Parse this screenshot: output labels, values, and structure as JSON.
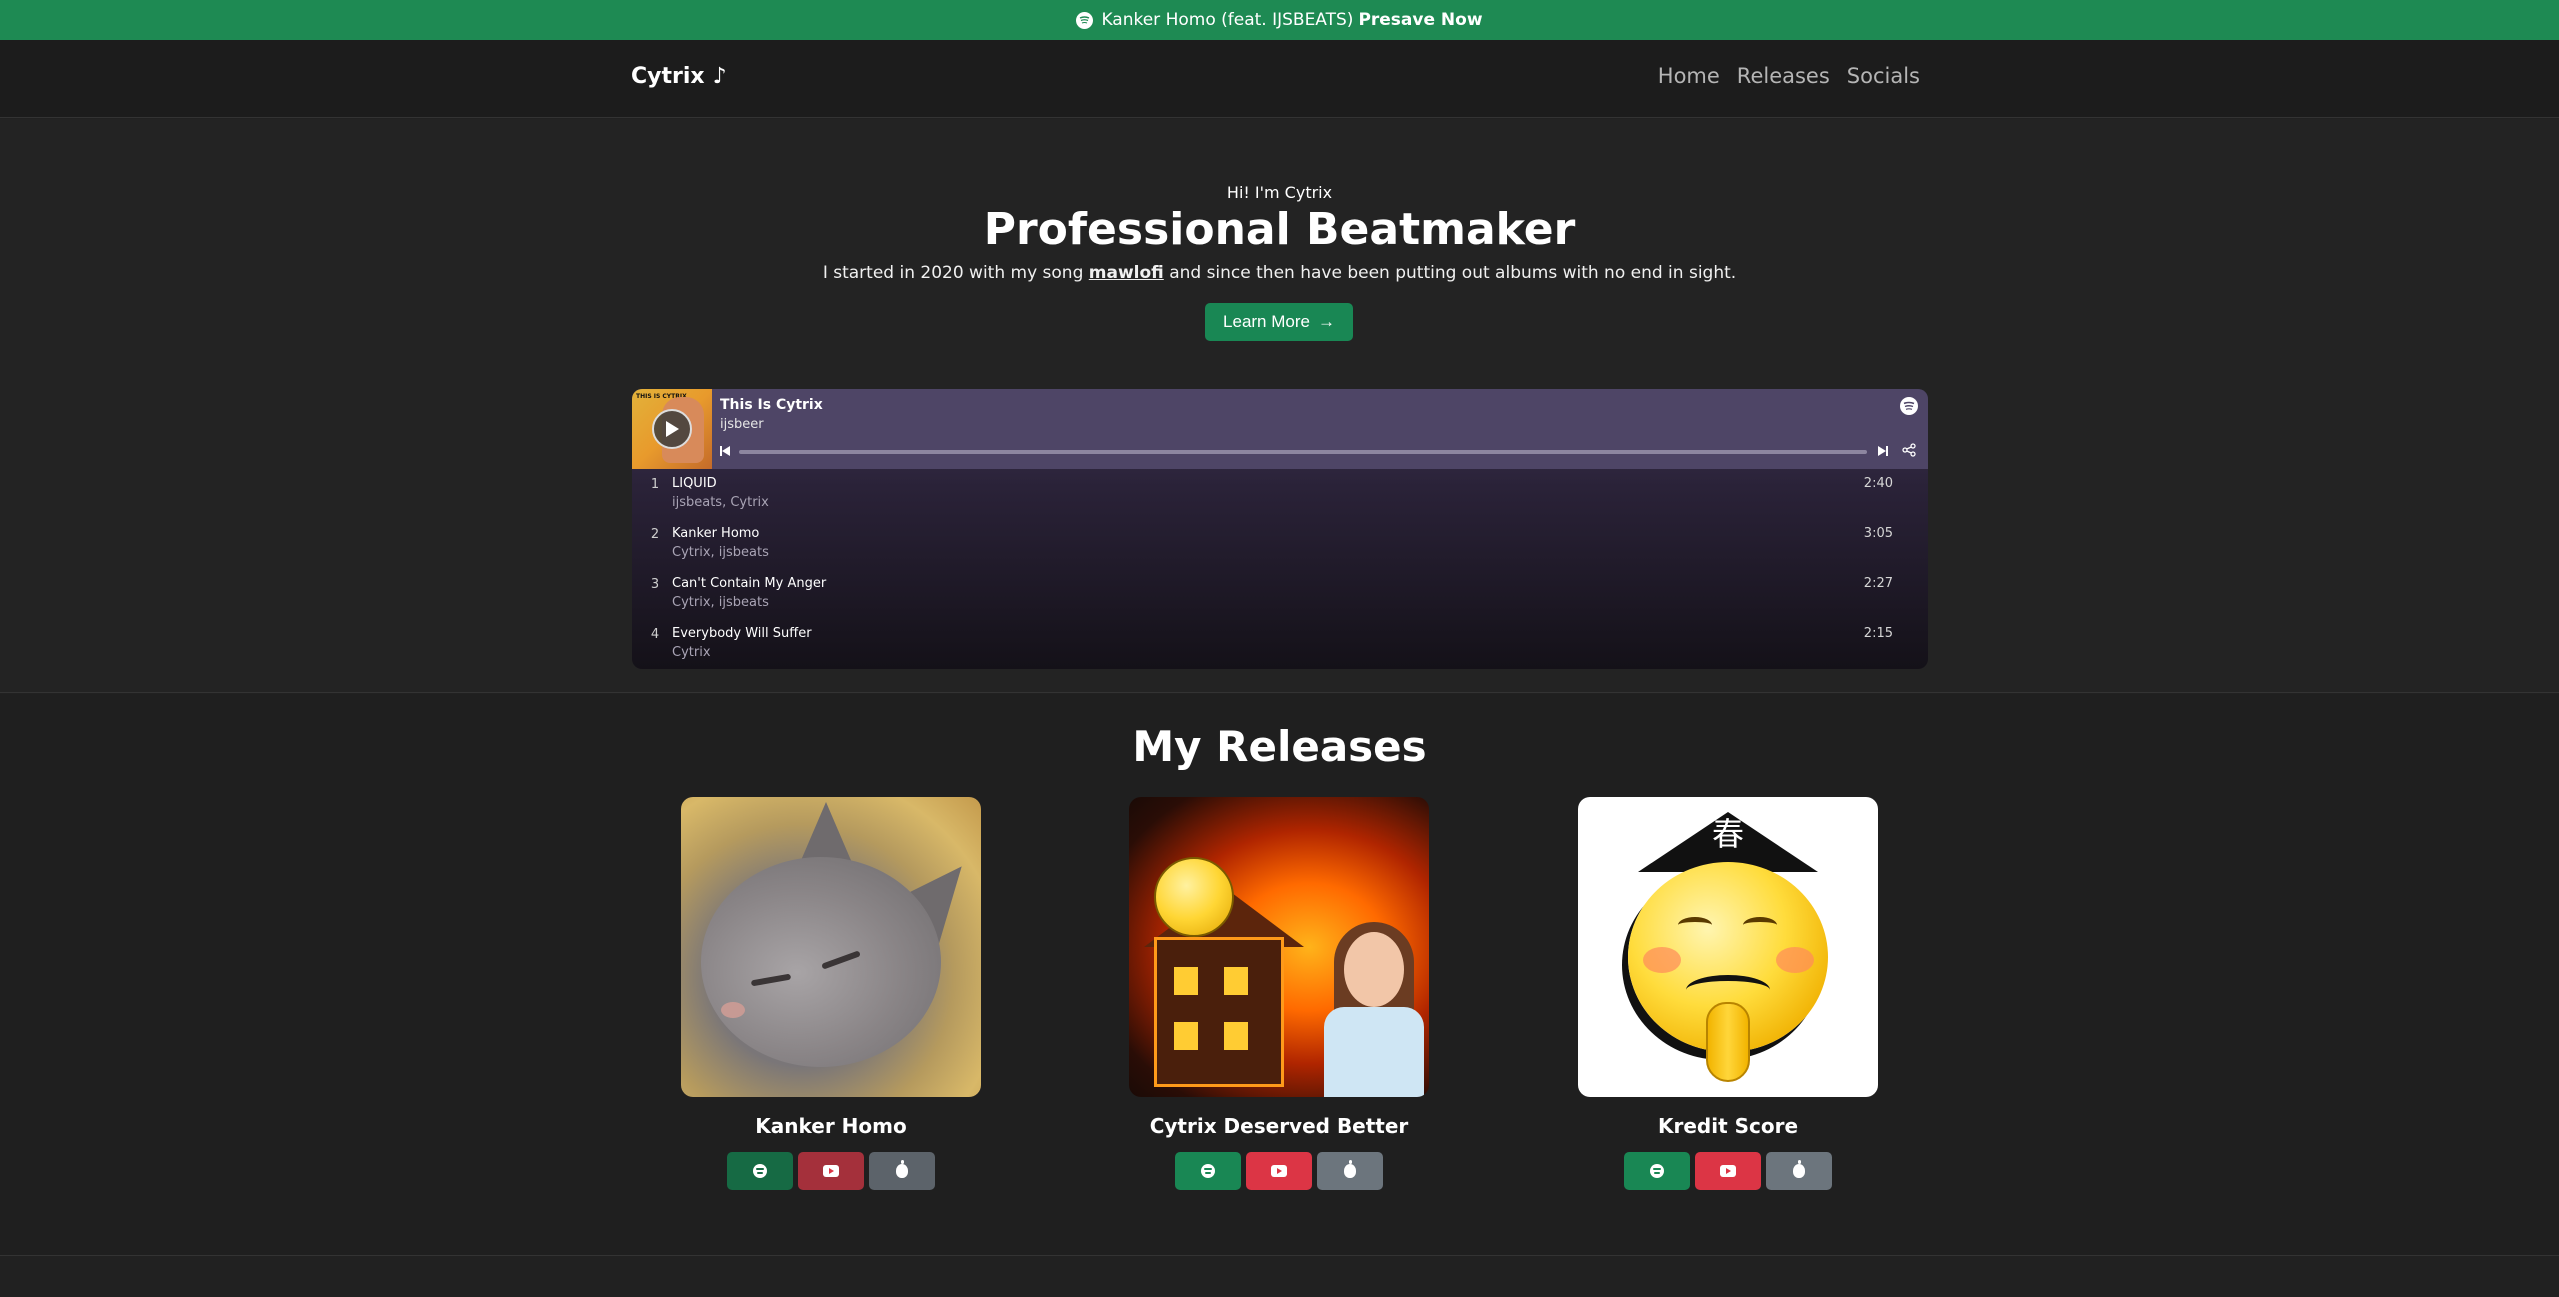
{
  "announcement": {
    "text": "Kanker Homo (feat. IJSBEATS)",
    "cta": "Presave Now",
    "icon": "spotify-icon"
  },
  "navbar": {
    "brand": "Cytrix",
    "brand_icon": "♪",
    "links": [
      "Home",
      "Releases",
      "Socials"
    ]
  },
  "hero": {
    "greeting": "Hi! I'm Cytrix",
    "title": "Professional Beatmaker",
    "lead_before": "I started in 2020 with my song",
    "lead_link": "mawlofi",
    "lead_after": "and since then have been putting out albums with no end in sight.",
    "button_label": "Learn More",
    "button_icon": "→"
  },
  "embed": {
    "playlist_title": "This Is Cytrix",
    "owner": "ijsbeer",
    "cover_caption": "THIS IS CYTRIX",
    "tracks": [
      {
        "num": "1",
        "name": "LIQUID",
        "artists": "ijsbeats, Cytrix",
        "duration": "2:40"
      },
      {
        "num": "2",
        "name": "Kanker Homo",
        "artists": "Cytrix, ijsbeats",
        "duration": "3:05"
      },
      {
        "num": "3",
        "name": "Can't Contain My Anger",
        "artists": "Cytrix, ijsbeats",
        "duration": "2:27"
      },
      {
        "num": "4",
        "name": "Everybody Will Suffer",
        "artists": "Cytrix",
        "duration": "2:15"
      }
    ]
  },
  "releases": {
    "heading": "My Releases",
    "items": [
      {
        "title": "Kanker Homo",
        "art": "sleeping-cat"
      },
      {
        "title": "Cytrix Deserved Better",
        "art": "burning-house-meme"
      },
      {
        "title": "Kredit Score",
        "art": "chinese-emoji"
      }
    ]
  },
  "colors": {
    "accent_green": "#198754",
    "announce_bar": "#1e8a53",
    "youtube_red": "#dc3545",
    "apple_gray": "#6c757d",
    "background": "#212121"
  }
}
